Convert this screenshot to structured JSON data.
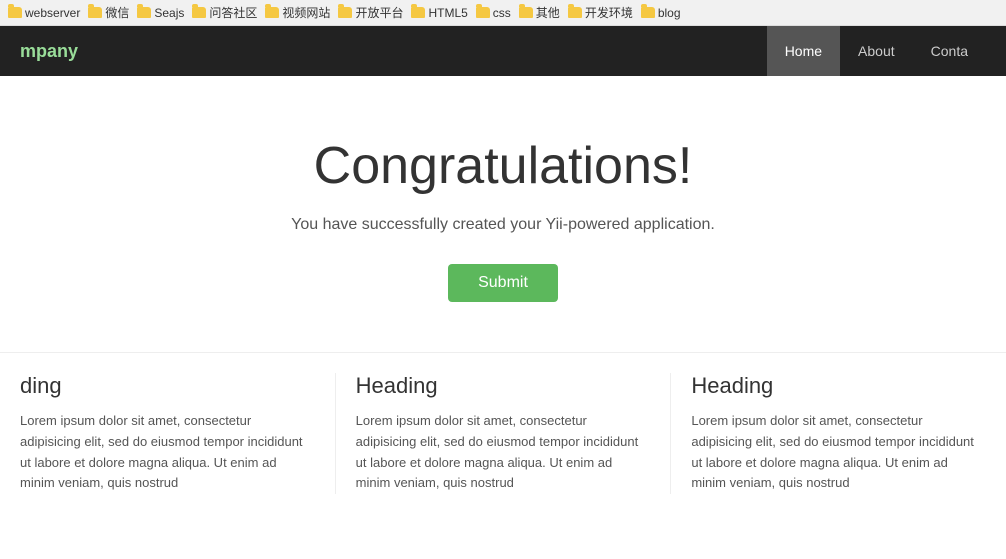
{
  "bookmarks": {
    "items": [
      {
        "label": "webserver"
      },
      {
        "label": "微信"
      },
      {
        "label": "Seajs"
      },
      {
        "label": "问答社区"
      },
      {
        "label": "视频网站"
      },
      {
        "label": "开放平台"
      },
      {
        "label": "HTML5"
      },
      {
        "label": "css"
      },
      {
        "label": "其他"
      },
      {
        "label": "开发环境"
      },
      {
        "label": "blog"
      }
    ]
  },
  "navbar": {
    "brand": "mpany",
    "items": [
      {
        "label": "Home",
        "active": true
      },
      {
        "label": "About",
        "active": false
      },
      {
        "label": "Conta",
        "active": false
      }
    ]
  },
  "hero": {
    "heading": "Congratulations!",
    "subtext": "You have successfully created your Yii-powered application.",
    "button_label": "Submit"
  },
  "columns": [
    {
      "heading": "ding",
      "body": " Lorem ipsum dolor sit amet, consectetur adipisicing elit, sed do eiusmod tempor incididunt ut labore et dolore magna aliqua. Ut enim ad minim veniam, quis nostrud"
    },
    {
      "heading": "Heading",
      "body": "Lorem ipsum dolor sit amet, consectetur adipisicing elit, sed do eiusmod tempor incididunt ut labore et dolore magna aliqua. Ut enim ad minim veniam, quis nostrud"
    },
    {
      "heading": "Heading",
      "body": "Lorem ipsum dolor sit amet, consectetur adipisicing elit, sed do eiusmod tempor incididunt ut labore et dolore magna aliqua. Ut enim ad minim veniam, quis nostrud"
    }
  ]
}
